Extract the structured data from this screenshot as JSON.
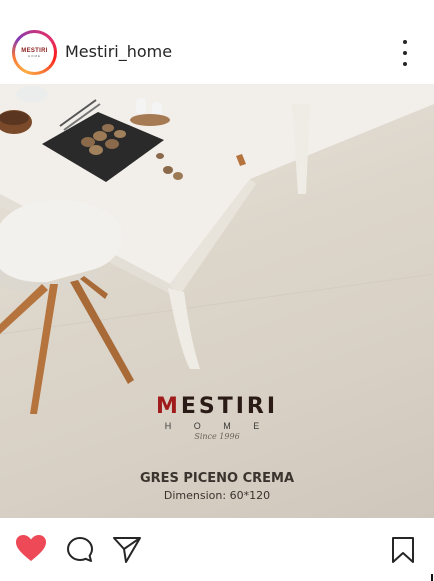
{
  "post": {
    "username": "Mestiri_home",
    "avatar": {
      "logo_text": "MESTIRI",
      "sub_text": "HOME"
    },
    "image": {
      "brand": "ESTIRI",
      "brand_initial": "M",
      "brand_sub": "H O M E",
      "since": "Since 1996",
      "product_name": "GRES PICENO CREMA",
      "dimension": "Dimension: 60*120"
    },
    "actions": {
      "like_icon": "heart-filled-icon",
      "comment_icon": "comment-bubble-icon",
      "share_icon": "paper-plane-icon",
      "bookmark_icon": "bookmark-icon",
      "liked": true
    }
  },
  "colors": {
    "like": "#ed4956",
    "text": "#262626",
    "brand_red": "#a01b1b"
  }
}
